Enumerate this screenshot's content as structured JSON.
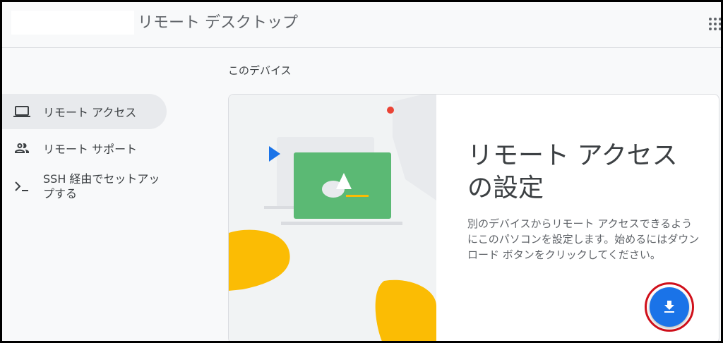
{
  "header": {
    "title": "リモート デスクトップ",
    "apps_icon": "apps-grid-icon"
  },
  "sidebar": {
    "items": [
      {
        "label": "リモート アクセス",
        "icon": "laptop-icon",
        "active": true
      },
      {
        "label": "リモート サポート",
        "icon": "people-icon",
        "active": false
      },
      {
        "label": "SSH 経由でセットアップする",
        "icon": "terminal-icon",
        "active": false
      }
    ]
  },
  "main": {
    "section_title": "このデバイス",
    "card": {
      "title": "リモート アクセスの設定",
      "description": "別のデバイスからリモート アクセスできるようにこのパソコンを設定します。始めるにはダウンロード ボタンをクリックしてください。",
      "download_icon": "download-icon"
    }
  },
  "colors": {
    "accent": "#1a73e8",
    "highlight_ring": "#d0101b",
    "illustration_green": "#5bb974",
    "illustration_yellow": "#fbbc04"
  }
}
